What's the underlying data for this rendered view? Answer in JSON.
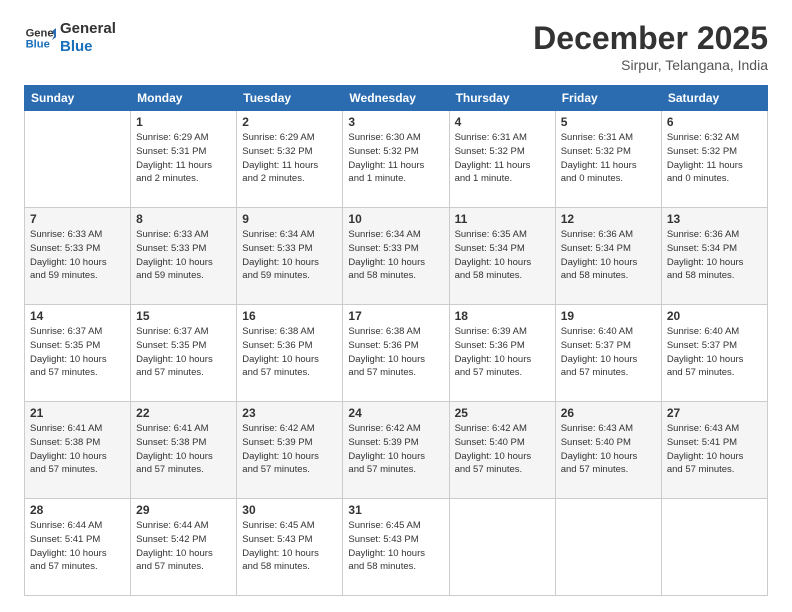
{
  "header": {
    "logo_line1": "General",
    "logo_line2": "Blue",
    "month": "December 2025",
    "location": "Sirpur, Telangana, India"
  },
  "weekdays": [
    "Sunday",
    "Monday",
    "Tuesday",
    "Wednesday",
    "Thursday",
    "Friday",
    "Saturday"
  ],
  "weeks": [
    [
      {
        "day": "",
        "info": ""
      },
      {
        "day": "1",
        "info": "Sunrise: 6:29 AM\nSunset: 5:31 PM\nDaylight: 11 hours\nand 2 minutes."
      },
      {
        "day": "2",
        "info": "Sunrise: 6:29 AM\nSunset: 5:32 PM\nDaylight: 11 hours\nand 2 minutes."
      },
      {
        "day": "3",
        "info": "Sunrise: 6:30 AM\nSunset: 5:32 PM\nDaylight: 11 hours\nand 1 minute."
      },
      {
        "day": "4",
        "info": "Sunrise: 6:31 AM\nSunset: 5:32 PM\nDaylight: 11 hours\nand 1 minute."
      },
      {
        "day": "5",
        "info": "Sunrise: 6:31 AM\nSunset: 5:32 PM\nDaylight: 11 hours\nand 0 minutes."
      },
      {
        "day": "6",
        "info": "Sunrise: 6:32 AM\nSunset: 5:32 PM\nDaylight: 11 hours\nand 0 minutes."
      }
    ],
    [
      {
        "day": "7",
        "info": "Sunrise: 6:33 AM\nSunset: 5:33 PM\nDaylight: 10 hours\nand 59 minutes."
      },
      {
        "day": "8",
        "info": "Sunrise: 6:33 AM\nSunset: 5:33 PM\nDaylight: 10 hours\nand 59 minutes."
      },
      {
        "day": "9",
        "info": "Sunrise: 6:34 AM\nSunset: 5:33 PM\nDaylight: 10 hours\nand 59 minutes."
      },
      {
        "day": "10",
        "info": "Sunrise: 6:34 AM\nSunset: 5:33 PM\nDaylight: 10 hours\nand 58 minutes."
      },
      {
        "day": "11",
        "info": "Sunrise: 6:35 AM\nSunset: 5:34 PM\nDaylight: 10 hours\nand 58 minutes."
      },
      {
        "day": "12",
        "info": "Sunrise: 6:36 AM\nSunset: 5:34 PM\nDaylight: 10 hours\nand 58 minutes."
      },
      {
        "day": "13",
        "info": "Sunrise: 6:36 AM\nSunset: 5:34 PM\nDaylight: 10 hours\nand 58 minutes."
      }
    ],
    [
      {
        "day": "14",
        "info": "Sunrise: 6:37 AM\nSunset: 5:35 PM\nDaylight: 10 hours\nand 57 minutes."
      },
      {
        "day": "15",
        "info": "Sunrise: 6:37 AM\nSunset: 5:35 PM\nDaylight: 10 hours\nand 57 minutes."
      },
      {
        "day": "16",
        "info": "Sunrise: 6:38 AM\nSunset: 5:36 PM\nDaylight: 10 hours\nand 57 minutes."
      },
      {
        "day": "17",
        "info": "Sunrise: 6:38 AM\nSunset: 5:36 PM\nDaylight: 10 hours\nand 57 minutes."
      },
      {
        "day": "18",
        "info": "Sunrise: 6:39 AM\nSunset: 5:36 PM\nDaylight: 10 hours\nand 57 minutes."
      },
      {
        "day": "19",
        "info": "Sunrise: 6:40 AM\nSunset: 5:37 PM\nDaylight: 10 hours\nand 57 minutes."
      },
      {
        "day": "20",
        "info": "Sunrise: 6:40 AM\nSunset: 5:37 PM\nDaylight: 10 hours\nand 57 minutes."
      }
    ],
    [
      {
        "day": "21",
        "info": "Sunrise: 6:41 AM\nSunset: 5:38 PM\nDaylight: 10 hours\nand 57 minutes."
      },
      {
        "day": "22",
        "info": "Sunrise: 6:41 AM\nSunset: 5:38 PM\nDaylight: 10 hours\nand 57 minutes."
      },
      {
        "day": "23",
        "info": "Sunrise: 6:42 AM\nSunset: 5:39 PM\nDaylight: 10 hours\nand 57 minutes."
      },
      {
        "day": "24",
        "info": "Sunrise: 6:42 AM\nSunset: 5:39 PM\nDaylight: 10 hours\nand 57 minutes."
      },
      {
        "day": "25",
        "info": "Sunrise: 6:42 AM\nSunset: 5:40 PM\nDaylight: 10 hours\nand 57 minutes."
      },
      {
        "day": "26",
        "info": "Sunrise: 6:43 AM\nSunset: 5:40 PM\nDaylight: 10 hours\nand 57 minutes."
      },
      {
        "day": "27",
        "info": "Sunrise: 6:43 AM\nSunset: 5:41 PM\nDaylight: 10 hours\nand 57 minutes."
      }
    ],
    [
      {
        "day": "28",
        "info": "Sunrise: 6:44 AM\nSunset: 5:41 PM\nDaylight: 10 hours\nand 57 minutes."
      },
      {
        "day": "29",
        "info": "Sunrise: 6:44 AM\nSunset: 5:42 PM\nDaylight: 10 hours\nand 57 minutes."
      },
      {
        "day": "30",
        "info": "Sunrise: 6:45 AM\nSunset: 5:43 PM\nDaylight: 10 hours\nand 58 minutes."
      },
      {
        "day": "31",
        "info": "Sunrise: 6:45 AM\nSunset: 5:43 PM\nDaylight: 10 hours\nand 58 minutes."
      },
      {
        "day": "",
        "info": ""
      },
      {
        "day": "",
        "info": ""
      },
      {
        "day": "",
        "info": ""
      }
    ]
  ]
}
